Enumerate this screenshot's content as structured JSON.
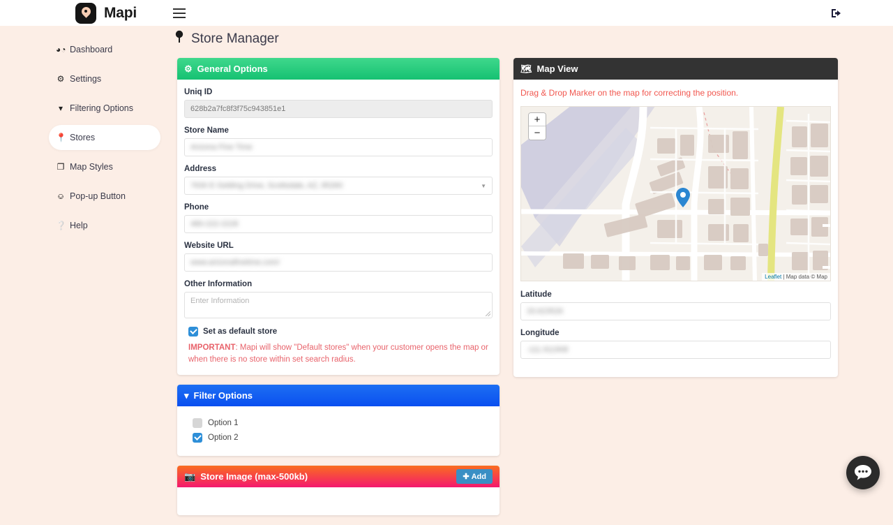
{
  "app": {
    "brand_name": "Mapi",
    "menu_icon": "hamburger-icon",
    "logout_icon": "sign-out-icon"
  },
  "sidebar": {
    "items": [
      {
        "label": "Dashboard",
        "icon": "dashboard-icon",
        "active": false
      },
      {
        "label": "Settings",
        "icon": "gear-icon",
        "active": false
      },
      {
        "label": "Filtering Options",
        "icon": "funnel-icon",
        "active": false
      },
      {
        "label": "Stores",
        "icon": "map-pin-icon",
        "active": true
      },
      {
        "label": "Map Styles",
        "icon": "layers-icon",
        "active": false
      },
      {
        "label": "Pop-up Button",
        "icon": "toggle-icon",
        "active": false
      },
      {
        "label": "Help",
        "icon": "question-circle-icon",
        "active": false
      }
    ]
  },
  "page": {
    "title": "Store Manager",
    "title_icon": "map-pin-icon"
  },
  "general_options": {
    "header": "General Options",
    "header_icon": "gear-icon",
    "fields": {
      "uniq_id": {
        "label": "Uniq ID",
        "value": "628b2a7fc8f3f75c943851e1",
        "disabled": true,
        "blurred": false
      },
      "store_name": {
        "label": "Store Name",
        "value": "Arizona Fine Time",
        "disabled": false,
        "blurred": true
      },
      "address": {
        "label": "Address",
        "value": "7630 E Gelding Drive, Scottsdale, AZ, 85260",
        "disabled": false,
        "blurred": true
      },
      "phone": {
        "label": "Phone",
        "value": "480-222-2228",
        "disabled": false,
        "blurred": true
      },
      "website": {
        "label": "Website URL",
        "value": "www.arizonafinetime.com/",
        "disabled": false,
        "blurred": true
      },
      "other_info": {
        "label": "Other Information",
        "value": "",
        "placeholder": "Enter Information"
      }
    },
    "default_store": {
      "label": "Set as default store",
      "checked": true
    },
    "important_prefix": "IMPORTANT",
    "important_text": ": Mapi will show \"Default stores\" when your customer opens the map or when there is no store within set search radius."
  },
  "filter_options": {
    "header": "Filter Options",
    "header_icon": "funnel-icon",
    "options": [
      {
        "label": "Option 1",
        "checked": false
      },
      {
        "label": "Option 2",
        "checked": true
      }
    ]
  },
  "store_image": {
    "header": "Store Image (max-500kb)",
    "header_icon": "image-icon",
    "add_label": "Add",
    "add_icon": "plus-icon"
  },
  "map_view": {
    "header": "Map View",
    "header_icon": "map-icon",
    "drag_note": "Drag & Drop Marker on the map for correcting the position.",
    "zoom_in": "+",
    "zoom_out": "−",
    "attribution_leaflet": "Leaflet",
    "attribution_text": "| Map data © Map",
    "marker_icon": "map-marker-icon",
    "latitude": {
      "label": "Latitude",
      "value": "33.623526",
      "blurred": true
    },
    "longitude": {
      "label": "Longitude",
      "value": "-111.911908",
      "blurred": true
    }
  },
  "chat_widget": {
    "icon": "chat-bubble-icon"
  },
  "colors": {
    "page_bg": "#fceee6",
    "green": "#16c172",
    "blue": "#0a4ff0",
    "orange": "#f96d1f",
    "pink": "#f4196f",
    "dark": "#333333",
    "alert_red": "#f1564e",
    "accent_blue": "#2e8fd8"
  }
}
